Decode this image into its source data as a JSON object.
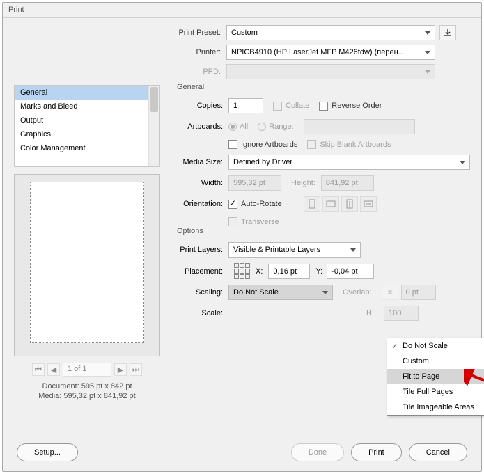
{
  "title": "Print",
  "top": {
    "preset_label": "Print Preset:",
    "preset_value": "Custom",
    "printer_label": "Printer:",
    "printer_value": "NPICB4910 (HP LaserJet MFP M426fdw) (перен...",
    "ppd_label": "PPD:"
  },
  "sidebar": {
    "items": [
      "General",
      "Marks and Bleed",
      "Output",
      "Graphics",
      "Color Management"
    ]
  },
  "preview": {
    "pager": "1 of 1",
    "doc": "Document: 595 pt x 842 pt",
    "media": "Media: 595,32 pt x 841,92 pt"
  },
  "general": {
    "legend": "General",
    "copies_label": "Copies:",
    "copies_value": "1",
    "collate": "Collate",
    "reverse": "Reverse Order",
    "artboards_label": "Artboards:",
    "all": "All",
    "range": "Range:",
    "ignore": "Ignore Artboards",
    "skip": "Skip Blank Artboards",
    "media_label": "Media Size:",
    "media_value": "Defined by Driver",
    "width_label": "Width:",
    "width_value": "595,32 pt",
    "height_label": "Height:",
    "height_value": "841,92 pt",
    "orient_label": "Orientation:",
    "autorotate": "Auto-Rotate",
    "transverse": "Transverse"
  },
  "options": {
    "legend": "Options",
    "layers_label": "Print Layers:",
    "layers_value": "Visible & Printable Layers",
    "placement_label": "Placement:",
    "x_label": "X:",
    "x_value": "0,16 pt",
    "y_label": "Y:",
    "y_value": "-0,04 pt",
    "scaling_label": "Scaling:",
    "scaling_value": "Do Not Scale",
    "overlap_label": "Overlap:",
    "overlap_value": "0 pt",
    "scale_label": "Scale:",
    "h_label": "H:",
    "h_value": "100"
  },
  "scaling_menu": [
    "Do Not Scale",
    "Custom",
    "Fit to Page",
    "Tile Full Pages",
    "Tile Imageable Areas"
  ],
  "buttons": {
    "setup": "Setup...",
    "done": "Done",
    "print": "Print",
    "cancel": "Cancel"
  }
}
